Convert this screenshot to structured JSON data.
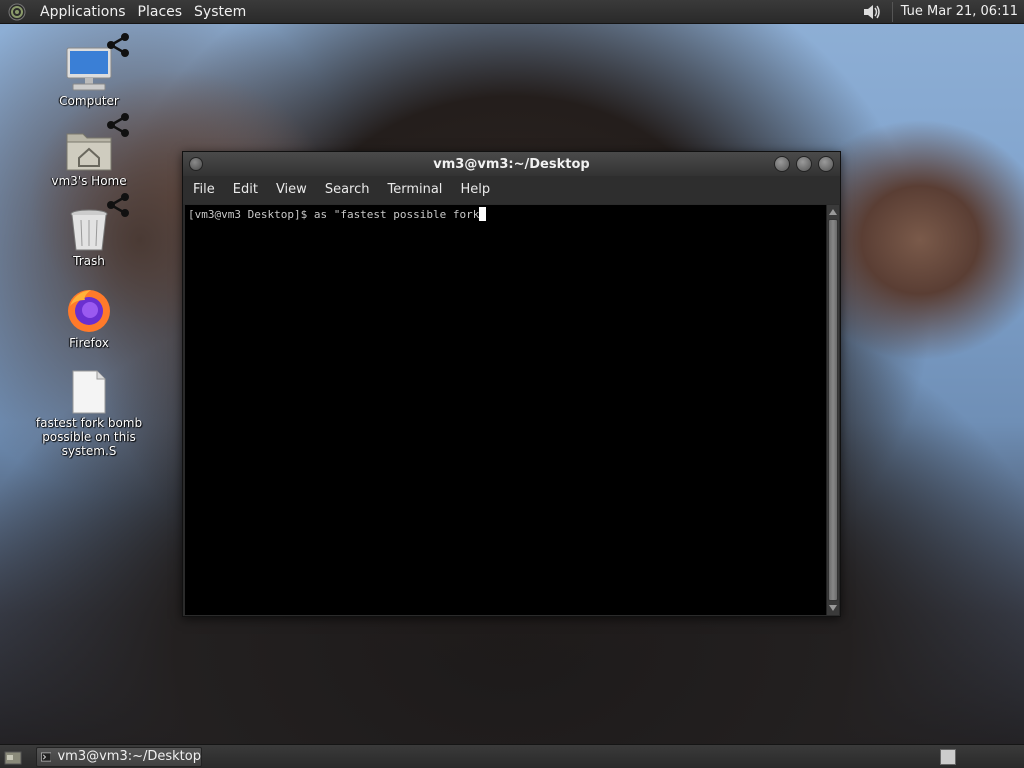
{
  "top_panel": {
    "menus": [
      "Applications",
      "Places",
      "System"
    ],
    "clock": "Tue Mar 21, 06:11",
    "icons": {
      "logo": "gnome-foot-icon",
      "volume": "speaker-icon"
    }
  },
  "desktop": {
    "icons": [
      {
        "label": "Computer",
        "icon": "computer-icon"
      },
      {
        "label": "vm3's Home",
        "icon": "home-folder-icon"
      },
      {
        "label": "Trash",
        "icon": "trash-icon"
      },
      {
        "label": "Firefox",
        "icon": "firefox-icon"
      },
      {
        "label": "fastest fork bomb possible on this system.S",
        "icon": "file-icon"
      }
    ]
  },
  "terminal": {
    "title": "vm3@vm3:~/Desktop",
    "menus": [
      "File",
      "Edit",
      "View",
      "Search",
      "Terminal",
      "Help"
    ],
    "line": "[vm3@vm3 Desktop]$ as \"fastest possible fork"
  },
  "bottom_panel": {
    "task_label": "vm3@vm3:~/Desktop"
  },
  "colors": {
    "panel": "#2f2f2f",
    "terminal_bg": "#000000",
    "terminal_fg": "#c8c8c8"
  }
}
